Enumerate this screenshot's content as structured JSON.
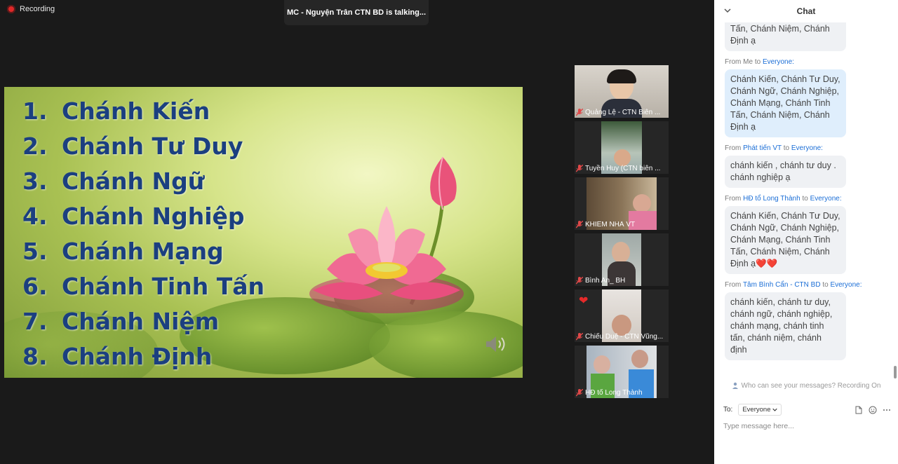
{
  "meeting": {
    "recording_label": "Recording",
    "talking_banner": "MC - Nguyện Trân CTN BD is talking..."
  },
  "slide": {
    "items": [
      {
        "num": "1.",
        "text": "Chánh Kiến"
      },
      {
        "num": "2.",
        "text": "Chánh Tư Duy"
      },
      {
        "num": "3.",
        "text": "Chánh Ngữ"
      },
      {
        "num": "4.",
        "text": "Chánh Nghiệp"
      },
      {
        "num": "5.",
        "text": "Chánh Mạng"
      },
      {
        "num": "6.",
        "text": "Chánh Tinh Tấn"
      },
      {
        "num": "7.",
        "text": "Chánh Niệm"
      },
      {
        "num": "8.",
        "text": "Chánh Định"
      }
    ]
  },
  "participants": [
    {
      "name": "Quảng Lệ - CTN Biên ...",
      "muted": true
    },
    {
      "name": "Tuyền Huy (CTN biên ...",
      "muted": true
    },
    {
      "name": "KHIÊM NHÃ VT",
      "muted": true
    },
    {
      "name": "Bình An_ BH",
      "muted": true
    },
    {
      "name": "Chiếu Duệ - CTN Vũng...",
      "muted": true,
      "reaction": "❤"
    },
    {
      "name": "HĐ tổ Long Thành",
      "muted": true
    }
  ],
  "chat": {
    "title": "Chat",
    "messages": [
      {
        "meta_from": "",
        "sender": "",
        "meta_to": "",
        "recipient": "",
        "text": "Chánh Mạng, Chánh Tinh Tấn, Chánh Niệm, Chánh Định ạ",
        "own": false
      },
      {
        "meta_from": "From",
        "sender": "Me",
        "meta_to": "to",
        "recipient": "Everyone:",
        "text": "Chánh Kiến, Chánh Tư Duy, Chánh Ngữ, Chánh Nghiệp, Chánh Mạng, Chánh Tinh Tấn, Chánh Niệm, Chánh Định ạ",
        "own": true
      },
      {
        "meta_from": "From",
        "sender": "Phát tiến VT",
        "meta_to": "to",
        "recipient": "Everyone:",
        "text": "chánh kiến , chánh  tư duy . chánh nghiệp ạ",
        "own": false
      },
      {
        "meta_from": "From",
        "sender": "HĐ tổ Long Thành",
        "meta_to": "to",
        "recipient": "Everyone:",
        "text": "Chánh Kiến, Chánh Tư Duy, Chánh Ngữ, Chánh Nghiệp, Chánh Mạng, Chánh Tinh Tấn, Chánh Niệm, Chánh Định ạ❤️❤️",
        "own": false
      },
      {
        "meta_from": "From",
        "sender": "Tâm Bình Cẩn - CTN BD",
        "meta_to": "to",
        "recipient": "Everyone:",
        "text": "chánh kiến, chánh tư duy, chánh ngữ, chánh nghiệp, chánh mạng, chánh tinh tấn, chánh niệm, chánh định",
        "own": false
      }
    ],
    "notice": "Who can see your messages? Recording On",
    "to_label": "To:",
    "to_value": "Everyone",
    "input_placeholder": "Type message here..."
  }
}
